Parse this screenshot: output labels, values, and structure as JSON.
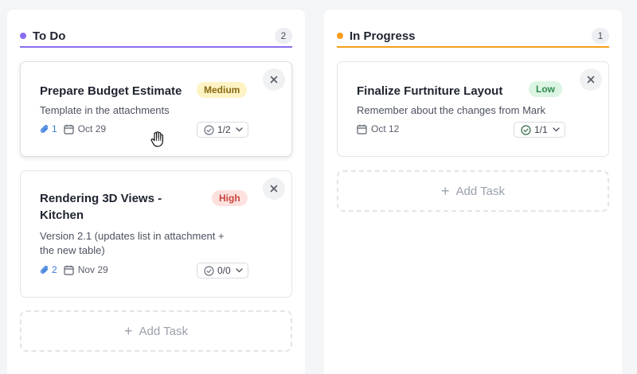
{
  "colors": {
    "todo_accent": "#8b6cf0",
    "progress_accent": "#f59e1c",
    "medium_bg": "#fdf3c4",
    "medium_fg": "#8a6a12",
    "high_bg": "#fde1df",
    "high_fg": "#c8463c",
    "low_bg": "#dcf5e3",
    "low_fg": "#2f8a4e"
  },
  "columns": [
    {
      "title": "To Do",
      "count": "2",
      "add_label": "Add Task",
      "cards": [
        {
          "title": "Prepare Budget Estimate",
          "priority": "Medium",
          "description": "Template in the attachments",
          "attachments": "1",
          "date": "Oct 29",
          "subtasks": "1/2",
          "icons": [
            "close-icon",
            "paperclip-icon",
            "calendar-icon",
            "check-circle-icon",
            "chevron-down-icon"
          ]
        },
        {
          "title_line1": "Rendering 3D Views -",
          "title_line2": "Kitchen",
          "priority": "High",
          "description_line1": "Version 2.1 (updates list in attachment +",
          "description_line2": "the new table)",
          "attachments": "2",
          "date": "Nov 29",
          "subtasks": "0/0"
        }
      ]
    },
    {
      "title": "In Progress",
      "count": "1",
      "add_label": "Add Task",
      "cards": [
        {
          "title": "Finalize Furtniture Layout",
          "priority": "Low",
          "description": "Remember about the changes from Mark",
          "date": "Oct 12",
          "subtasks": "1/1"
        }
      ]
    }
  ]
}
